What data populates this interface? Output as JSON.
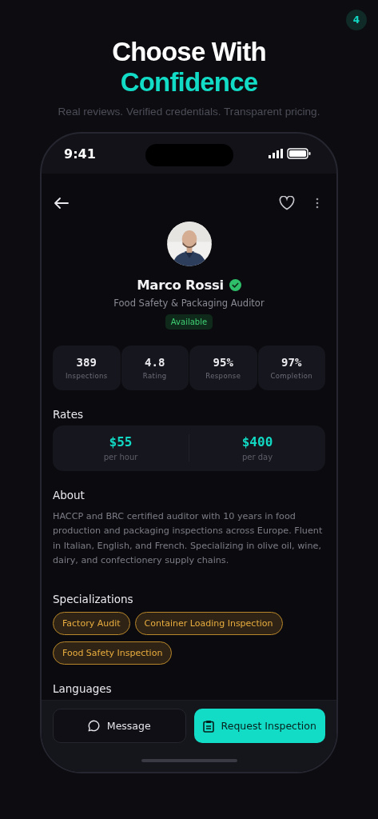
{
  "page_badge": "4",
  "headline": {
    "line_1": "Choose With",
    "line_2": "Confidence"
  },
  "tagline": "Real reviews. Verified credentials. Transparent pricing.",
  "status_bar": {
    "time": "9:41"
  },
  "profile": {
    "name": "Marco Rossi",
    "verified": true,
    "title": "Food Safety & Packaging Auditor",
    "availability": "Available",
    "favorite": false
  },
  "stats": [
    {
      "value": "389",
      "label": "Inspections"
    },
    {
      "value": "4.8",
      "label": "Rating"
    },
    {
      "value": "95%",
      "label": "Response"
    },
    {
      "value": "97%",
      "label": "Completion"
    }
  ],
  "rates": {
    "heading": "Rates",
    "items": [
      {
        "amount": "$55",
        "unit": "per hour"
      },
      {
        "amount": "$400",
        "unit": "per day"
      }
    ]
  },
  "about": {
    "heading": "About",
    "text": "HACCP and BRC certified auditor with 10 years in food production and packaging inspections across Europe. Fluent in Italian, English, and French. Specializing in olive oil, wine, dairy, and confectionery supply chains."
  },
  "specializations": {
    "heading": "Specializations",
    "items": [
      "Factory Audit",
      "Container Loading Inspection",
      "Food Safety Inspection"
    ]
  },
  "languages": {
    "heading": "Languages"
  },
  "actions": [
    {
      "kind": "secondary",
      "label": "Message"
    },
    {
      "kind": "primary",
      "label": "Request Inspection"
    }
  ]
}
